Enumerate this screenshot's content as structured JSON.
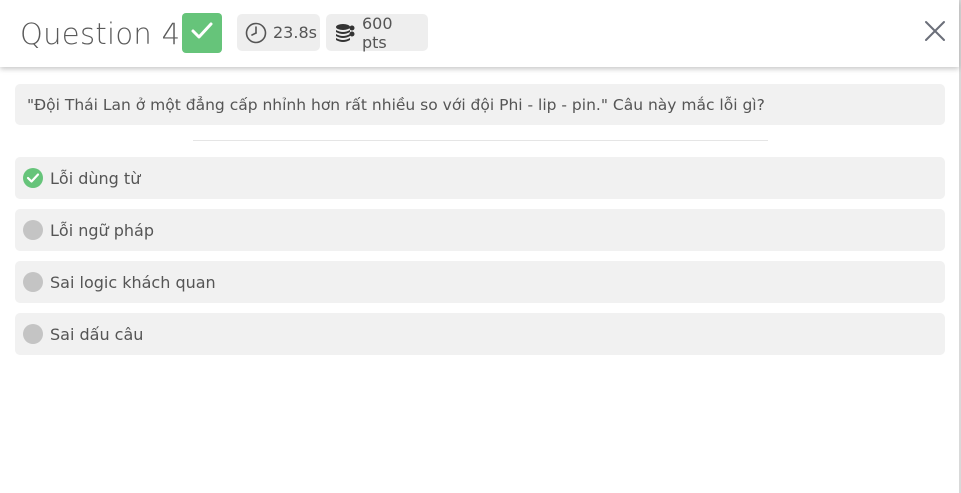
{
  "header": {
    "title": "Question 4",
    "status_icon": "check-icon",
    "time": "23.8s",
    "points": "600 pts",
    "close_icon": "close-icon"
  },
  "question": {
    "text": "\"Đội Thái Lan ở một đẳng cấp nhỉnh hơn rất nhiều so với đội Phi - lip - pin.\" Câu này mắc lỗi gì?"
  },
  "options": [
    {
      "label": "Lỗi dùng từ",
      "state": "correct"
    },
    {
      "label": "Lỗi ngữ pháp",
      "state": "unselected"
    },
    {
      "label": "Sai logic khách quan",
      "state": "unselected"
    },
    {
      "label": "Sai dấu câu",
      "state": "unselected"
    }
  ],
  "colors": {
    "correct": "#66c47a",
    "unselected": "#c4c4c4",
    "box_background": "#f1f1f1",
    "text": "#555555"
  }
}
